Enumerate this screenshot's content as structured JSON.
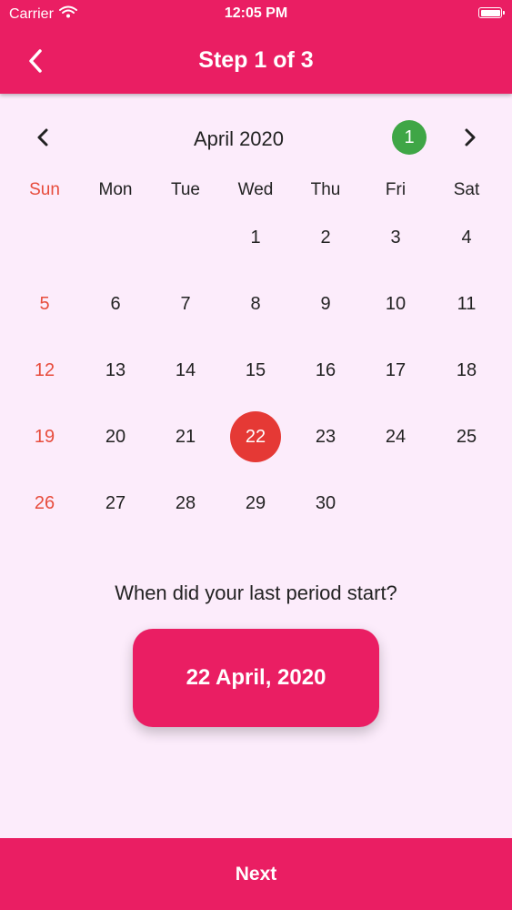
{
  "status_bar": {
    "carrier": "Carrier",
    "time": "12:05 PM"
  },
  "header": {
    "title": "Step 1 of 3"
  },
  "calendar": {
    "month_label": "April 2020",
    "badge": "1",
    "weekdays": [
      "Sun",
      "Mon",
      "Tue",
      "Wed",
      "Thu",
      "Fri",
      "Sat"
    ],
    "weeks": [
      [
        "",
        "",
        "",
        "1",
        "2",
        "3",
        "4"
      ],
      [
        "5",
        "6",
        "7",
        "8",
        "9",
        "10",
        "11"
      ],
      [
        "12",
        "13",
        "14",
        "15",
        "16",
        "17",
        "18"
      ],
      [
        "19",
        "20",
        "21",
        "22",
        "23",
        "24",
        "25"
      ],
      [
        "26",
        "27",
        "28",
        "29",
        "30",
        "",
        ""
      ]
    ],
    "selected_day": "22"
  },
  "question": "When did your last period start?",
  "selected_date_button": "22 April, 2020",
  "next_button": "Next",
  "colors": {
    "primary": "#ea1e63",
    "background": "#fcecfb",
    "sunday": "#e74c3c",
    "selected": "#e53935",
    "badge": "#3fa646"
  }
}
